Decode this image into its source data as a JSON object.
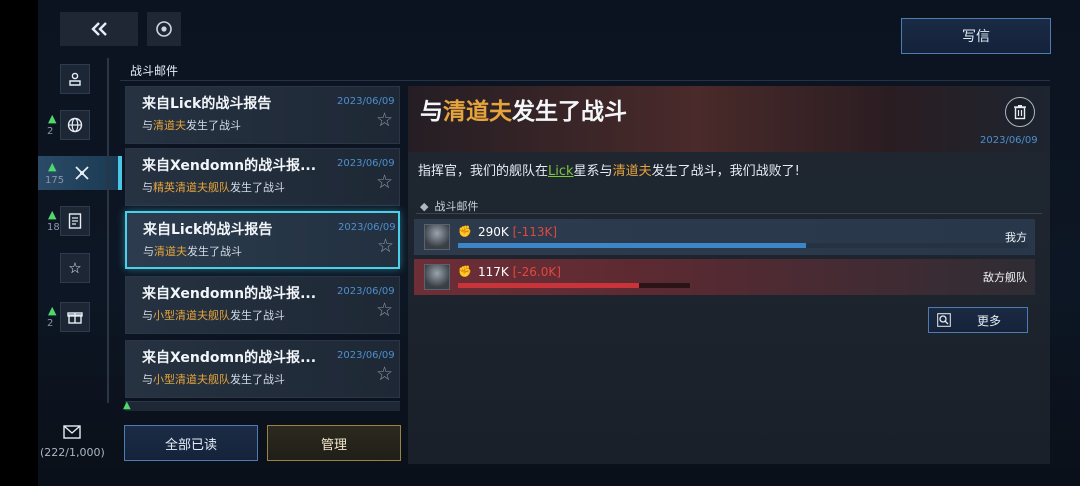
{
  "top": {
    "write_label": "写信"
  },
  "sidebar": {
    "categories": [
      {
        "icon": "user-inbox-icon",
        "alert": "",
        "count": ""
      },
      {
        "icon": "globe-icon",
        "alert": "▲",
        "count": "2"
      },
      {
        "icon": "battle-icon",
        "alert": "▲",
        "count": "175"
      },
      {
        "icon": "document-icon",
        "alert": "▲",
        "count": "18"
      },
      {
        "icon": "star-icon",
        "alert": "",
        "count": ""
      },
      {
        "icon": "gift-icon",
        "alert": "▲",
        "count": "2"
      }
    ],
    "mailbox_count": "(222/1,000)"
  },
  "section_title": "战斗邮件",
  "mails": [
    {
      "title": "来自Lick的战斗报告",
      "date": "2023/06/09",
      "pre": "与",
      "hl": "清道夫",
      "post": "发生了战斗"
    },
    {
      "title": "来自Xendomn的战斗报...",
      "date": "2023/06/09",
      "pre": "与",
      "hl": "精英清道夫舰队",
      "post": "发生了战斗"
    },
    {
      "title": "来自Lick的战斗报告",
      "date": "2023/06/09",
      "pre": "与",
      "hl": "清道夫",
      "post": "发生了战斗"
    },
    {
      "title": "来自Xendomn的战斗报...",
      "date": "2023/06/09",
      "pre": "与",
      "hl": "小型清道夫舰队",
      "post": "发生了战斗"
    },
    {
      "title": "来自Xendomn的战斗报...",
      "date": "2023/06/09",
      "pre": "与",
      "hl": "小型清道夫舰队",
      "post": "发生了战斗"
    }
  ],
  "buttons": {
    "read_all": "全部已读",
    "manage": "管理",
    "more": "更多"
  },
  "detail": {
    "title_pre": "与",
    "title_hl": "清道夫",
    "title_post": "发生了战斗",
    "date": "2023/06/09",
    "body_1": "指挥官，我们的舰队在",
    "body_link": "Lick",
    "body_2": "星系与",
    "body_hl": "清道夫",
    "body_3": "发生了战斗，我们战败了!",
    "report_label": "战斗邮件",
    "fleets": [
      {
        "power": "290K",
        "loss": "[-113K]",
        "side": "我方",
        "bar_fraction": 0.61,
        "bar_color": "#3d86c6",
        "track_color": "#243244"
      },
      {
        "power": "117K",
        "loss": "[-26.0K]",
        "side": "敌方舰队",
        "bar_fraction": 0.78,
        "bar_color": "#c8343a",
        "track_color": "#2a1416"
      }
    ]
  },
  "colors": {
    "accent_cyan": "#4bd0ea",
    "highlight_orange": "#e5a43c",
    "date_blue": "#4d8fcf",
    "alert_green": "#4fd96a"
  }
}
